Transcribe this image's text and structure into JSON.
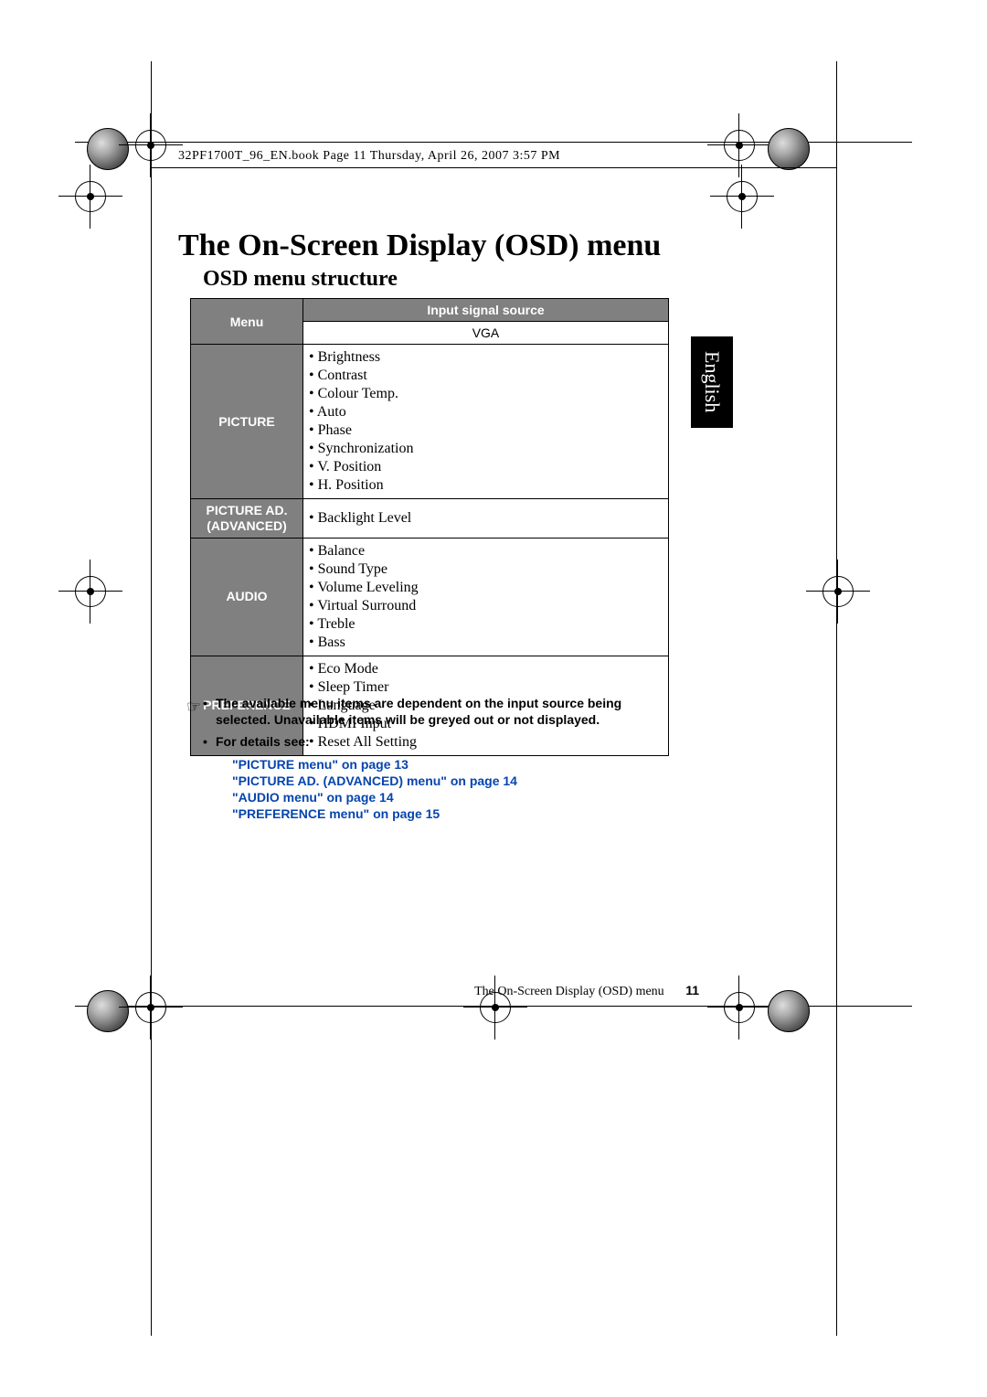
{
  "book_header": "32PF1700T_96_EN.book  Page 11  Thursday, April 26, 2007  3:57 PM",
  "title": "The On-Screen Display (OSD) menu",
  "subtitle": "OSD menu structure",
  "side_tab": "English",
  "table": {
    "header_menu": "Menu",
    "header_source": "Input signal source",
    "vga": "VGA",
    "rows": [
      {
        "label": "PICTURE",
        "items": [
          "Brightness",
          "Contrast",
          "Colour Temp.",
          "Auto",
          "Phase",
          "Synchronization",
          "V. Position",
          "H. Position"
        ]
      },
      {
        "label": "PICTURE AD. (ADVANCED)",
        "items": [
          "Backlight Level"
        ]
      },
      {
        "label": "AUDIO",
        "items": [
          "Balance",
          "Sound Type",
          "Volume Leveling",
          "Virtual Surround",
          "Treble",
          "Bass"
        ]
      },
      {
        "label": "PREFERENCE",
        "items": [
          "Eco Mode",
          "Sleep Timer",
          "Language",
          "HDMI Input",
          "Reset All Setting"
        ]
      }
    ]
  },
  "notes": {
    "line1": "The available menu items are dependent on the input source being selected. Unavailable items will be greyed out or not displayed.",
    "line2": "For details see:",
    "links": [
      "\"PICTURE menu\" on page 13",
      "\"PICTURE AD. (ADVANCED) menu\" on page 14",
      "\"AUDIO menu\" on page 14",
      "\"PREFERENCE menu\" on page 15"
    ]
  },
  "footer_text": "The On-Screen Display (OSD) menu",
  "page_number": "11"
}
